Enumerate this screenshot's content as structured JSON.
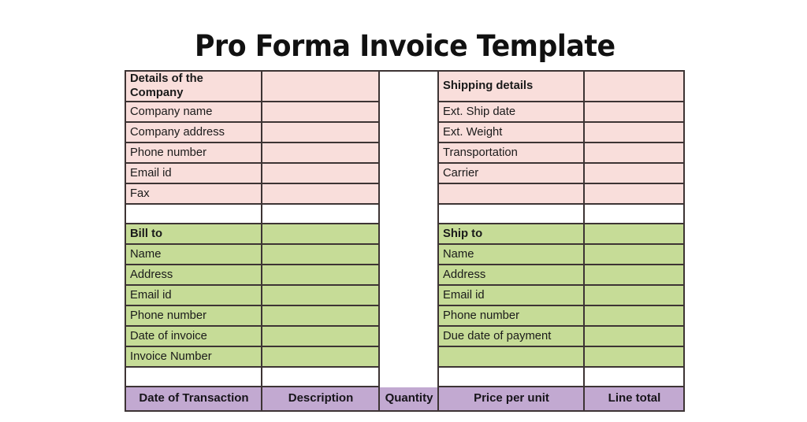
{
  "document": {
    "title": "Pro Forma Invoice Template"
  },
  "colors": {
    "pink": "#f9dedb",
    "green": "#c6dc97",
    "purple": "#c2a9d1",
    "border": "#3d3434",
    "page": "#ffffff"
  },
  "sections": {
    "company": {
      "header": "Details of the Company",
      "rows": [
        "Company name",
        "Company address",
        "Phone number",
        "Email id",
        "Fax"
      ]
    },
    "shipping": {
      "header": "Shipping details",
      "rows": [
        "Ext. Ship date",
        "Ext. Weight",
        "Transportation",
        "Carrier",
        ""
      ]
    },
    "bill_to": {
      "header": "Bill to",
      "rows": [
        "Name",
        "Address",
        "Email id",
        "Phone number",
        "Date of invoice",
        "Invoice Number"
      ]
    },
    "ship_to": {
      "header": "Ship to",
      "rows": [
        "Name",
        "Address",
        "Email id",
        "Phone number",
        "Due date of payment",
        ""
      ]
    }
  },
  "line_items_header": {
    "date": "Date of Transaction",
    "description": "Description",
    "quantity": "Quantity",
    "price": "Price per unit",
    "total": "Line total"
  }
}
